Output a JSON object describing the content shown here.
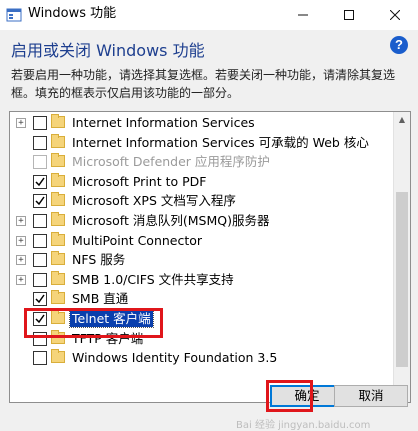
{
  "window": {
    "title": "Windows 功能",
    "controls": {
      "minimize_icon": "minimize-icon",
      "maximize_icon": "maximize-icon",
      "close_icon": "close-icon"
    }
  },
  "header": {
    "heading": "启用或关闭 Windows 功能",
    "help_glyph": "?",
    "description": "若要启用一种功能，请选择其复选框。若要关闭一种功能，请清除其复选框。填充的框表示仅启用该功能的一部分。"
  },
  "features": [
    {
      "label": "Internet Information Services",
      "expandable": true,
      "state": "unchecked",
      "disabled": false
    },
    {
      "label": "Internet Information Services 可承载的 Web 核心",
      "expandable": false,
      "state": "unchecked",
      "disabled": false
    },
    {
      "label": "Microsoft Defender 应用程序防护",
      "expandable": false,
      "state": "unchecked",
      "disabled": true
    },
    {
      "label": "Microsoft Print to PDF",
      "expandable": false,
      "state": "checked",
      "disabled": false
    },
    {
      "label": "Microsoft XPS 文档写入程序",
      "expandable": false,
      "state": "checked",
      "disabled": false
    },
    {
      "label": "Microsoft 消息队列(MSMQ)服务器",
      "expandable": true,
      "state": "unchecked",
      "disabled": false
    },
    {
      "label": "MultiPoint Connector",
      "expandable": true,
      "state": "unchecked",
      "disabled": false
    },
    {
      "label": "NFS 服务",
      "expandable": true,
      "state": "unchecked",
      "disabled": false
    },
    {
      "label": "SMB 1.0/CIFS 文件共享支持",
      "expandable": true,
      "state": "unchecked",
      "disabled": false
    },
    {
      "label": "SMB 直通",
      "expandable": false,
      "state": "checked",
      "disabled": false
    },
    {
      "label": "Telnet 客户端",
      "expandable": false,
      "state": "checked",
      "disabled": false,
      "selected": true
    },
    {
      "label": "TFTP 客户端",
      "expandable": false,
      "state": "unchecked",
      "disabled": false
    },
    {
      "label": "Windows Identity Foundation 3.5",
      "expandable": false,
      "state": "unchecked",
      "disabled": false
    }
  ],
  "buttons": {
    "ok": "确定",
    "cancel": "取消"
  },
  "watermark": "Bai 经验 jingyan.baidu.com",
  "colors": {
    "heading": "#1e3f8f",
    "selection": "#0a3fad",
    "highlight_box": "#e0161b",
    "help_badge": "#1a5dcc"
  }
}
